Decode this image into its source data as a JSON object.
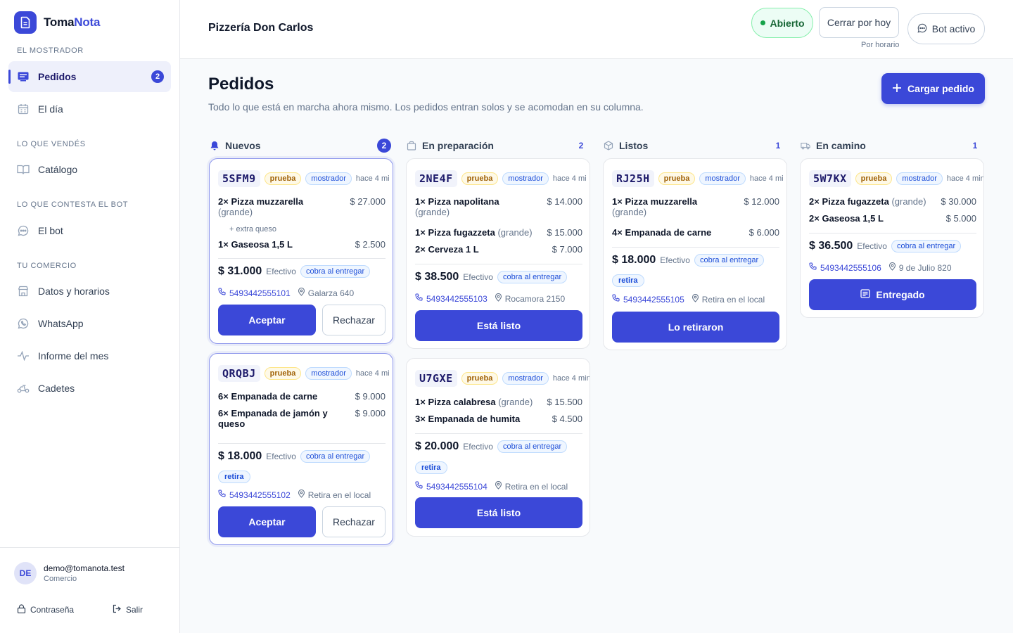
{
  "brand": {
    "name_part1": "Toma",
    "name_part2": "Nota"
  },
  "sidebar": {
    "sections": [
      "EL MOSTRADOR",
      "LO QUE VENDÉS",
      "LO QUE CONTESTA EL BOT",
      "TU COMERCIO"
    ],
    "items": [
      {
        "label": "Pedidos",
        "badge": "2",
        "icon": "orders-icon"
      },
      {
        "label": "El día",
        "icon": "calendar-icon"
      },
      {
        "label": "Catálogo",
        "icon": "book-icon"
      },
      {
        "label": "El bot",
        "icon": "chat-icon"
      },
      {
        "label": "Datos y horarios",
        "icon": "store-icon"
      },
      {
        "label": "WhatsApp",
        "icon": "whatsapp-icon"
      },
      {
        "label": "Informe del mes",
        "icon": "activity-icon"
      },
      {
        "label": "Cadetes",
        "icon": "scooter-icon"
      }
    ],
    "user": {
      "initials": "DE",
      "email": "demo@tomanota.test",
      "role": "Comercio"
    },
    "footer": {
      "password": "Contraseña",
      "logout": "Salir"
    }
  },
  "header": {
    "shop_name": "Pizzería Don Carlos",
    "status": "Abierto",
    "close_today": "Cerrar por hoy",
    "close_sub": "Por horario",
    "bot": "Bot activo"
  },
  "main": {
    "title": "Pedidos",
    "subtitle": "Todo lo que está en marcha ahora mismo. Los pedidos entran solos y se acomodan en su columna.",
    "load_button": "Cargar pedido"
  },
  "columns": [
    {
      "title": "Nuevos",
      "count": "2"
    },
    {
      "title": "En preparación",
      "count": "2"
    },
    {
      "title": "Listos",
      "count": "1"
    },
    {
      "title": "En camino",
      "count": "1"
    }
  ],
  "common": {
    "tag_test": "prueba",
    "tag_counter": "mostrador",
    "time_full": "hace 4 min",
    "time_clip": "hace 4 mi",
    "pay": "Efectivo",
    "cobra": "cobra al entregar",
    "retira": "retira",
    "retira_local": "Retira en el local"
  },
  "orders": {
    "o1": {
      "code": "5SFM9",
      "l1": {
        "qty": "2×",
        "name": "Pizza muzzarella",
        "size": "(grande)",
        "price": "$ 27.000"
      },
      "extra": "+ extra queso",
      "l2": {
        "qty": "1×",
        "name": "Gaseosa 1,5 L",
        "price": "$ 2.500"
      },
      "total": "$ 31.000",
      "phone": "5493442555101",
      "addr": "Galarza 640",
      "accept": "Aceptar",
      "reject": "Rechazar"
    },
    "o2": {
      "code": "QRQBJ",
      "l1": {
        "qty": "6×",
        "name": "Empanada de carne",
        "price": "$ 9.000"
      },
      "l2": {
        "qty": "6×",
        "name": "Empanada de jamón y",
        "name2": "queso",
        "price": "$ 9.000"
      },
      "total": "$ 18.000",
      "phone": "5493442555102",
      "accept": "Aceptar",
      "reject": "Rechazar"
    },
    "o3": {
      "code": "2NE4F",
      "l1": {
        "qty": "1×",
        "name": "Pizza napolitana",
        "size": "(grande)",
        "price": "$ 14.000"
      },
      "l2": {
        "qty": "1×",
        "name": "Pizza fugazzeta",
        "size": "(grande)",
        "price": "$ 15.000"
      },
      "l3": {
        "qty": "2×",
        "name": "Cerveza 1 L",
        "price": "$ 7.000"
      },
      "total": "$ 38.500",
      "phone": "5493442555103",
      "addr": "Rocamora 2150",
      "action": "Está listo"
    },
    "o4": {
      "code": "U7GXE",
      "l1": {
        "qty": "1×",
        "name": "Pizza calabresa",
        "size": "(grande)",
        "price": "$ 15.500"
      },
      "l2": {
        "qty": "3×",
        "name": "Empanada de humita",
        "price": "$ 4.500"
      },
      "total": "$ 20.000",
      "phone": "5493442555104",
      "action": "Está listo"
    },
    "o5": {
      "code": "RJ25H",
      "l1": {
        "qty": "1×",
        "name": "Pizza muzzarella",
        "size": "(grande)",
        "price": "$ 12.000"
      },
      "l2": {
        "qty": "4×",
        "name": "Empanada de carne",
        "price": "$ 6.000"
      },
      "total": "$ 18.000",
      "phone": "5493442555105",
      "action": "Lo retiraron"
    },
    "o6": {
      "code": "5W7KX",
      "l1": {
        "qty": "2×",
        "name": "Pizza fugazzeta",
        "size": "(grande)",
        "price": "$ 30.000"
      },
      "l2": {
        "qty": "2×",
        "name": "Gaseosa 1,5 L",
        "price": "$ 5.000"
      },
      "total": "$ 36.500",
      "phone": "5493442555106",
      "addr": "9 de Julio 820",
      "action": "Entregado"
    }
  },
  "colors": {
    "accent": "#3b48d8",
    "open_green": "#16a34a",
    "sidebar_active_bg": "#eef0fb"
  }
}
